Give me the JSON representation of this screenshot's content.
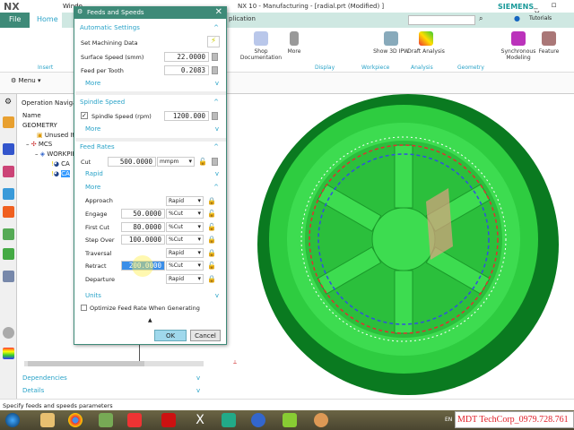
{
  "app": {
    "logo": "NX",
    "title": "NX 10 - Manufacturing - [radial.prt (Modified) ]",
    "brand": "SIEMENS",
    "window_fragment": "Windo",
    "app_tab_fragment": "plication",
    "tutorials": "Tutorials"
  },
  "tabs": {
    "file": "File",
    "home": "Home"
  },
  "ribbon": {
    "insert_group": "Insert",
    "shop_doc": "Shop Documentation",
    "more": "More",
    "show3d": "Show 3D IPW",
    "draft": "Draft Analysis",
    "sync": "Synchronous Modeling",
    "feature": "Feature",
    "groups": [
      "Display",
      "Workpiece",
      "Analysis",
      "Geometry"
    ]
  },
  "toolbar": {
    "menu": "Menu"
  },
  "nav": {
    "title": "Operation Navigator",
    "column": "Name",
    "items": [
      "GEOMETRY",
      "Unused Items",
      "MCS",
      "WORKPIECE",
      "CA",
      "CA"
    ],
    "dependencies": "Dependencies",
    "details": "Details"
  },
  "dialog": {
    "title": "Feeds and Speeds",
    "auto": {
      "header": "Automatic Settings",
      "set_data": "Set Machining Data",
      "surface_speed_label": "Surface Speed (smm)",
      "surface_speed": "22.0000",
      "feed_tooth_label": "Feed per Tooth",
      "feed_tooth": "0.2083",
      "more": "More"
    },
    "spindle": {
      "header": "Spindle Speed",
      "label": "Spindle Speed (rpm)",
      "value": "1200.000",
      "checked": true,
      "more": "More"
    },
    "feed": {
      "header": "Feed Rates",
      "cut_label": "Cut",
      "cut": "500.0000",
      "cut_unit": "mmpm",
      "rapid": "Rapid",
      "more": "More",
      "rows": [
        {
          "label": "Approach",
          "value": "",
          "unit": "Rapid"
        },
        {
          "label": "Engage",
          "value": "50.0000",
          "unit": "%Cut"
        },
        {
          "label": "First Cut",
          "value": "80.0000",
          "unit": "%Cut"
        },
        {
          "label": "Step Over",
          "value": "100.0000",
          "unit": "%Cut"
        },
        {
          "label": "Traversal",
          "value": "",
          "unit": "Rapid"
        },
        {
          "label": "Retract",
          "value": "200.0000",
          "unit": "%Cut"
        },
        {
          "label": "Departure",
          "value": "",
          "unit": "Rapid"
        }
      ],
      "units": "Units",
      "optimize": "Optimize Feed Rate When Generating"
    },
    "ok": "OK",
    "cancel": "Cancel"
  },
  "status": "Specify feeds and speeds parameters",
  "watermark": "MDT TechCorp_0979.728.761",
  "taskbar": {
    "lang": "EN"
  },
  "colors": {
    "teal": "#3e8a78",
    "accent": "#2aa3c8",
    "part_green": "#2ecc40"
  }
}
